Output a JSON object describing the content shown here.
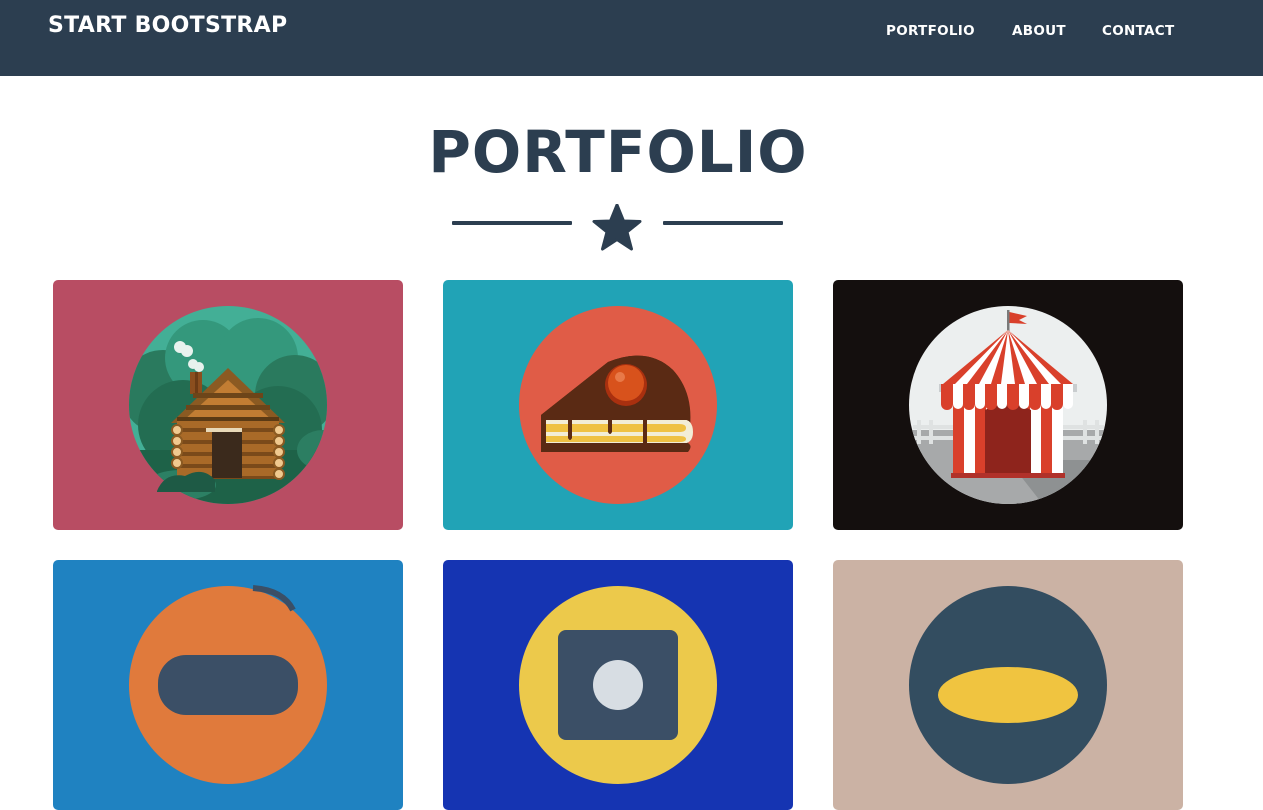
{
  "navbar": {
    "brand": "START BOOTSTRAP",
    "links": [
      {
        "label": "PORTFOLIO"
      },
      {
        "label": "ABOUT"
      },
      {
        "label": "CONTACT"
      }
    ],
    "background": "#2c3e50"
  },
  "portfolio": {
    "title": "PORTFOLIO",
    "divider_icon": "star-icon",
    "items": [
      {
        "illustration": "cabin-icon",
        "background": "#b84d63"
      },
      {
        "illustration": "cake-icon",
        "background": "#21a3b6"
      },
      {
        "illustration": "circus-tent-icon",
        "background": "#140f0e"
      },
      {
        "illustration": "game-controller-icon",
        "background": "#1f82c1"
      },
      {
        "illustration": "safe-icon",
        "background": "#1534b2"
      },
      {
        "illustration": "submarine-icon",
        "background": "#cbb2a4"
      }
    ]
  },
  "colors": {
    "primary": "#2c3e50",
    "text_on_dark": "#ffffff"
  }
}
